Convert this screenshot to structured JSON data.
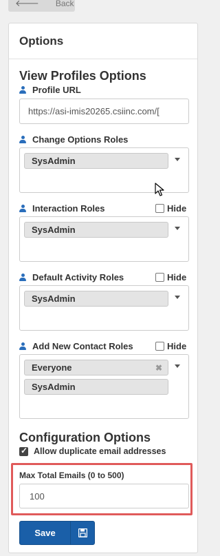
{
  "back_button": {
    "label": "Back"
  },
  "panel": {
    "title": "Options"
  },
  "view_profiles": {
    "title": "View Profiles Options",
    "profile_url": {
      "label": "Profile URL",
      "value": "https://asi-imis20265.csiinc.com/["
    },
    "change_options_roles": {
      "label": "Change Options Roles",
      "tags": [
        "SysAdmin"
      ]
    },
    "interaction_roles": {
      "label": "Interaction Roles",
      "tags": [
        "SysAdmin"
      ],
      "hide_label": "Hide",
      "hide_checked": false
    },
    "default_activity_roles": {
      "label": "Default Activity Roles",
      "tags": [
        "SysAdmin"
      ],
      "hide_label": "Hide",
      "hide_checked": false
    },
    "add_new_contact_roles": {
      "label": "Add New Contact Roles",
      "tags": [
        "Everyone",
        "SysAdmin"
      ],
      "remove_glyph": "✖",
      "hide_label": "Hide",
      "hide_checked": false
    }
  },
  "configuration": {
    "title": "Configuration Options",
    "allow_duplicates": {
      "label": "Allow duplicate email addresses",
      "checked": true
    },
    "max_total_emails": {
      "label": "Max Total Emails (0 to 500)",
      "value": "100"
    }
  },
  "save_button": {
    "label": "Save"
  },
  "colors": {
    "primary": "#1a5fa8",
    "icon": "#2a6ebb",
    "highlight": "#e05a5a"
  }
}
